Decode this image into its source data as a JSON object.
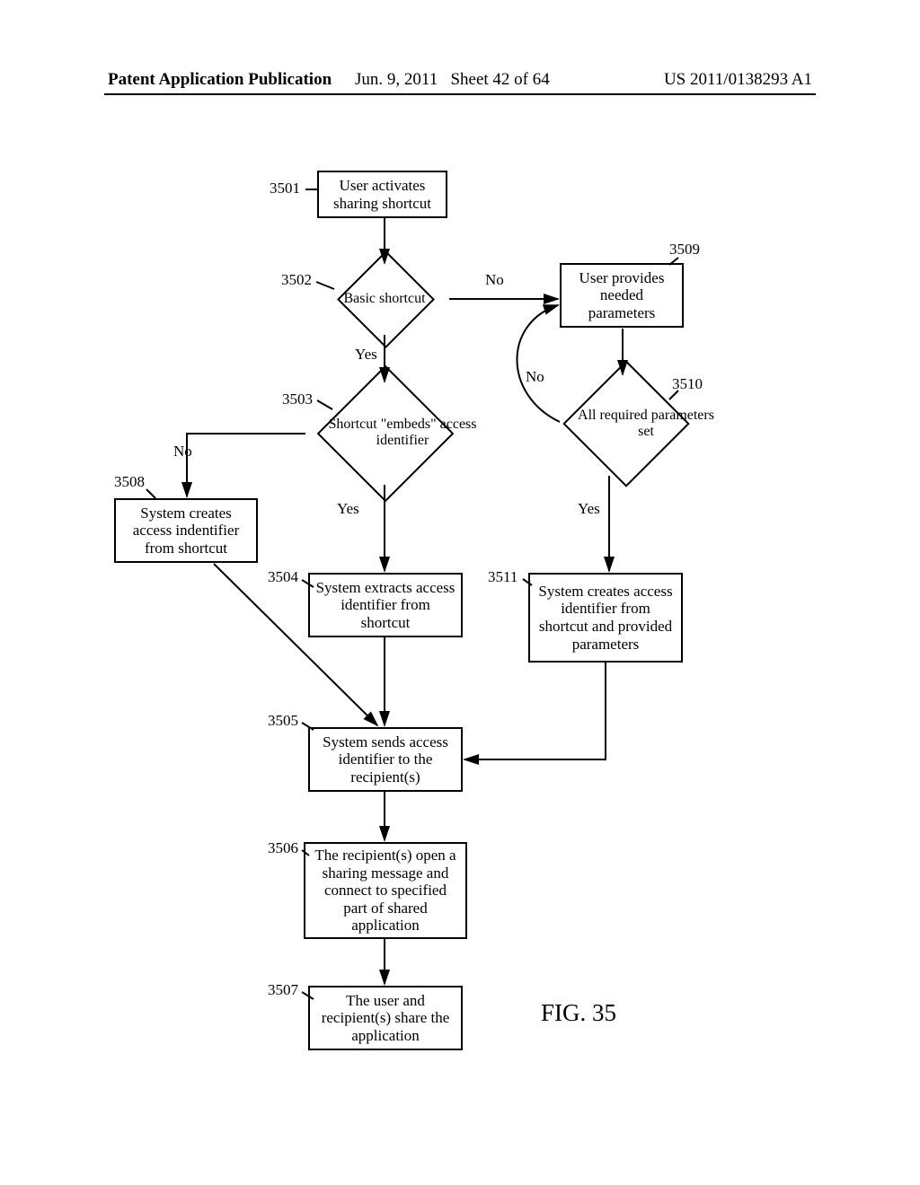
{
  "header": {
    "left": "Patent Application Publication",
    "date": "Jun. 9, 2011",
    "sheet": "Sheet 42 of 64",
    "pubno": "US 2011/0138293 A1"
  },
  "refs": {
    "r3501": "3501",
    "r3502": "3502",
    "r3503": "3503",
    "r3504": "3504",
    "r3505": "3505",
    "r3506": "3506",
    "r3507": "3507",
    "r3508": "3508",
    "r3509": "3509",
    "r3510": "3510",
    "r3511": "3511"
  },
  "boxes": {
    "b3501": "User activates sharing shortcut",
    "b3508": "System creates access indentifier from shortcut",
    "b3504": "System extracts access identifier from shortcut",
    "b3505": "System sends access identifier to the recipient(s)",
    "b3506": "The recipient(s) open a sharing message and connect to specified part of shared application",
    "b3507": "The user and recipient(s) share the application",
    "b3509": "User provides needed parameters",
    "b3511": "System creates access identifier from shortcut and provided parameters"
  },
  "diamonds": {
    "d3502": "Basic shortcut",
    "d3503": "Shortcut \"embeds\" access identifier",
    "d3510": "All required parameters set"
  },
  "edgeLabels": {
    "yes1": "Yes",
    "no1": "No",
    "yes2": "Yes",
    "no2": "No",
    "yes3": "Yes",
    "no3": "No"
  },
  "figure": "FIG. 35"
}
